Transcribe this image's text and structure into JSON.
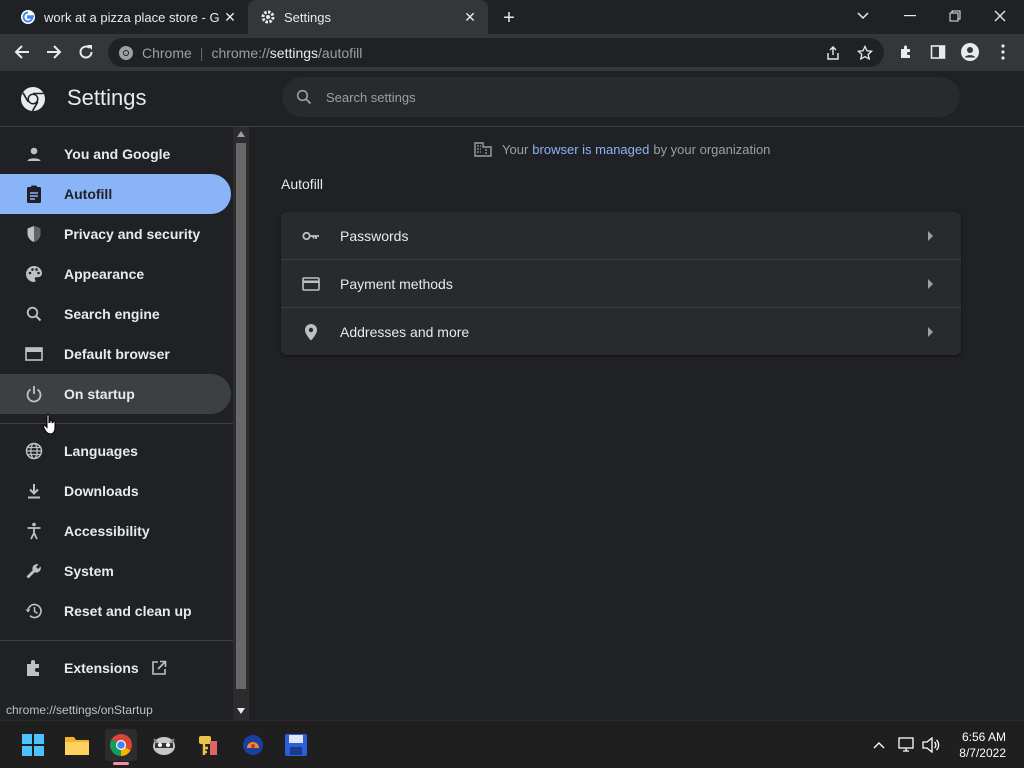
{
  "tabs": [
    {
      "title": "work at a pizza place store - Goo",
      "favicon": "google-icon"
    },
    {
      "title": "Settings",
      "favicon": "gear-icon",
      "active": true
    }
  ],
  "toolbar": {
    "chip_label": "Chrome",
    "url_scheme": "chrome://",
    "url_host": "settings",
    "url_path": "/autofill"
  },
  "settings": {
    "title": "Settings",
    "search_placeholder": "Search settings"
  },
  "sidebar": {
    "items": [
      {
        "label": "You and Google",
        "icon": "person-icon"
      },
      {
        "label": "Autofill",
        "icon": "clipboard-icon",
        "selected": true
      },
      {
        "label": "Privacy and security",
        "icon": "shield-icon"
      },
      {
        "label": "Appearance",
        "icon": "palette-icon"
      },
      {
        "label": "Search engine",
        "icon": "search-icon"
      },
      {
        "label": "Default browser",
        "icon": "browser-icon"
      },
      {
        "label": "On startup",
        "icon": "power-icon",
        "hovered": true
      },
      {
        "label": "Languages",
        "icon": "globe-icon"
      },
      {
        "label": "Downloads",
        "icon": "download-icon"
      },
      {
        "label": "Accessibility",
        "icon": "accessibility-icon"
      },
      {
        "label": "System",
        "icon": "wrench-icon"
      },
      {
        "label": "Reset and clean up",
        "icon": "history-icon"
      },
      {
        "label": "Extensions",
        "icon": "puzzle-icon"
      }
    ]
  },
  "main": {
    "managed_prefix": "Your",
    "managed_link": "browser is managed",
    "managed_suffix": "by your organization",
    "section_title": "Autofill",
    "rows": [
      {
        "label": "Passwords",
        "icon": "key-icon"
      },
      {
        "label": "Payment methods",
        "icon": "credit-card-icon"
      },
      {
        "label": "Addresses and more",
        "icon": "location-pin-icon"
      }
    ]
  },
  "status_url": "chrome://settings/onStartup",
  "taskbar": {
    "time": "6:56 AM",
    "date": "8/7/2022"
  },
  "colors": {
    "accent": "#8ab4f8",
    "background": "#202124",
    "card": "#292a2d"
  }
}
